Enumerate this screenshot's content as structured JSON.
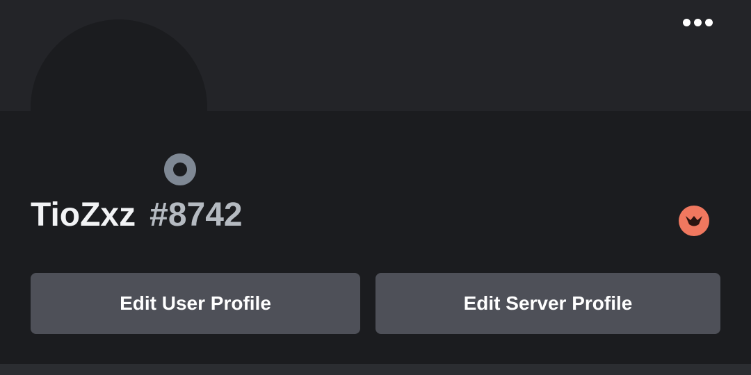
{
  "profile": {
    "username": "TioZxz",
    "discriminator": "#8742",
    "status": "offline"
  },
  "header": {
    "more_icon": "more-horizontal-icon"
  },
  "badges": [
    {
      "icon": "hypesquad-brilliance-badge-icon",
      "color": "#f0785f"
    }
  ],
  "actions": {
    "edit_user_profile": "Edit User Profile",
    "edit_server_profile": "Edit Server Profile"
  },
  "colors": {
    "background": "#1b1c1f",
    "banner": "#232428",
    "button": "#4e5058",
    "status_offline": "#7f8894",
    "badge": "#f0785f"
  }
}
